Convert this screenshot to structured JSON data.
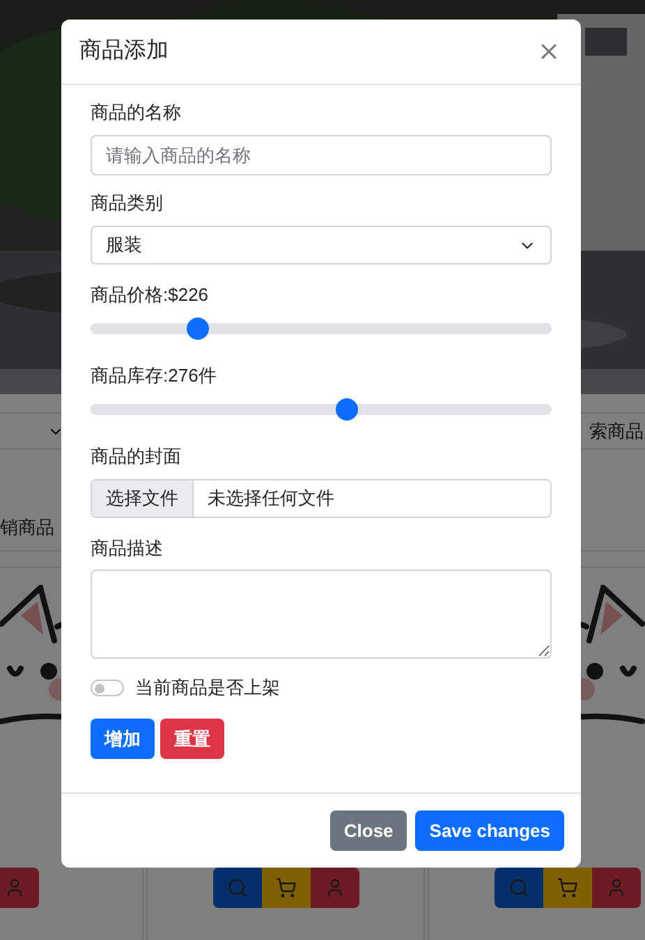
{
  "background": {
    "search_label": "索商品",
    "section_title": "销商品",
    "cards": [
      {
        "actions": [
          {
            "kind": "person"
          }
        ]
      },
      {
        "actions": [
          {
            "kind": "search"
          },
          {
            "kind": "cart"
          },
          {
            "kind": "person"
          }
        ]
      },
      {
        "actions": [
          {
            "kind": "search"
          },
          {
            "kind": "cart"
          },
          {
            "kind": "person"
          }
        ]
      }
    ]
  },
  "modal": {
    "title": "商品添加",
    "name_field": {
      "label": "商品的名称",
      "placeholder": "请输入商品的名称"
    },
    "category": {
      "label": "商品类别",
      "value": "服装"
    },
    "price": {
      "label": "商品价格:$226",
      "level": 0.22
    },
    "stock": {
      "label": "商品库存:276件",
      "level": 0.56
    },
    "cover": {
      "label": "商品的封面",
      "button": "选择文件",
      "status": "未选择任何文件"
    },
    "description": {
      "label": "商品描述"
    },
    "listed": {
      "label": "当前商品是否上架",
      "on": false
    },
    "form_buttons": [
      {
        "label": "增加",
        "kind": "primary"
      },
      {
        "label": "重置",
        "kind": "danger"
      }
    ],
    "footer_buttons": [
      {
        "label": "Close",
        "kind": "secondary"
      },
      {
        "label": "Save changes",
        "kind": "primary"
      }
    ]
  }
}
